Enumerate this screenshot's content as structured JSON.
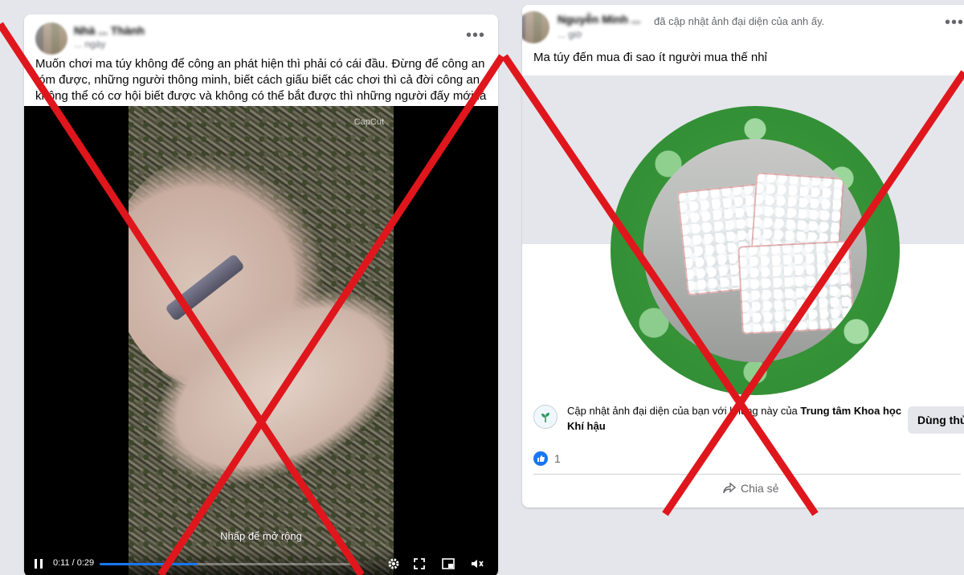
{
  "left_post": {
    "author_name": "Nhà ... Thành",
    "timestamp": "... ngày",
    "more_label": "•••",
    "text": "Muốn chơi ma túy không để công an phát hiện thì phải có cái đầu. Đừng để công an tóm được, những người thông minh, biết cách giấu biết các chơi thì cả đời công an không thể có cơ hội biết được và không có thể bắt được thì những người đấy mới là người giỏi",
    "video": {
      "watermark": "CapCut",
      "expand_hint": "Nhấp để mở rộng",
      "time": "0:11 / 0:29",
      "progress": 0.38
    }
  },
  "right_post": {
    "author_name": "Nguyễn Minh ...",
    "action_text": "đã cập nhật ảnh đại diện của anh ấy.",
    "timestamp": "... giờ",
    "more_label": "•••",
    "text": "Ma túy đến mua đi sao ít người mua thế nhỉ",
    "frame": {
      "prefix": "Cập nhật ảnh đại diện của bạn với khung này của ",
      "org": "Trung tâm Khoa học Khí hậu",
      "button_label": "Dùng thử"
    },
    "reaction_count": "1",
    "share_label": "Chia sẻ"
  },
  "colors": {
    "accent": "#1877f2",
    "cross": "#e0161d",
    "frame_green": "#2f8a32"
  }
}
